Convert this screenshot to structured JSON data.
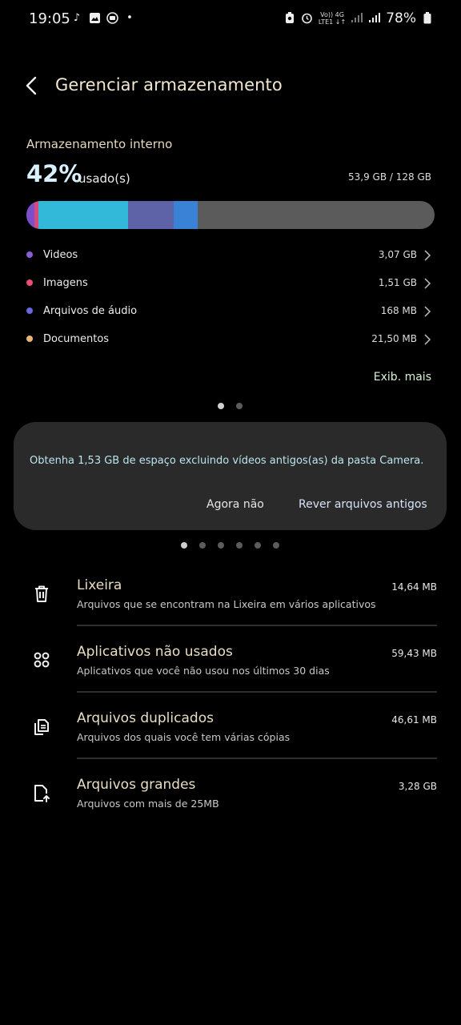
{
  "status_bar": {
    "time": "19:05",
    "battery": "78%",
    "network_top": "Vo)) 4G",
    "network_bottom": "LTE1 ↓↑"
  },
  "header": {
    "title": "Gerenciar armazenamento"
  },
  "storage": {
    "label": "Armazenamento interno",
    "percent": "42%",
    "used_label": "usado(s)",
    "total": "53,9 GB / 128 GB",
    "bar_segments": [
      {
        "name": "videos",
        "color": "#7b4fc9",
        "fraction": 0.02
      },
      {
        "name": "images",
        "color": "#d9487a",
        "fraction": 0.01
      },
      {
        "name": "other",
        "color": "#32b9d9",
        "fraction": 0.22
      },
      {
        "name": "system",
        "color": "#5e63a8",
        "fraction": 0.11
      },
      {
        "name": "apps",
        "color": "#3a82d6",
        "fraction": 0.06
      }
    ],
    "categories": [
      {
        "label": "Videos",
        "value": "3,07 GB",
        "color": "#8a5cd8"
      },
      {
        "label": "Imagens",
        "value": "1,51 GB",
        "color": "#e94f72"
      },
      {
        "label": "Arquivos de áudio",
        "value": "168 MB",
        "color": "#6a66e0"
      },
      {
        "label": "Documentos",
        "value": "21,50 MB",
        "color": "#e8b776"
      }
    ],
    "see_more": "Exib. mais"
  },
  "suggestion": {
    "text": "Obtenha 1,53 GB de espaço excluindo vídeos antigos(as) da pasta Camera.",
    "not_now": "Agora não",
    "review": "Rever arquivos antigos"
  },
  "options": [
    {
      "title": "Lixeira",
      "subtitle": "Arquivos que se encontram na Lixeira em vários aplicativos",
      "size": "14,64 MB",
      "icon": "trash-icon"
    },
    {
      "title": "Aplicativos não usados",
      "subtitle": "Aplicativos que você não usou nos últimos 30 dias",
      "size": "59,43 MB",
      "icon": "apps-icon"
    },
    {
      "title": "Arquivos duplicados",
      "subtitle": "Arquivos dos quais você tem várias cópias",
      "size": "46,61 MB",
      "icon": "duplicate-files-icon"
    },
    {
      "title": "Arquivos grandes",
      "subtitle": "Arquivos com mais de 25MB",
      "size": "3,28 GB",
      "icon": "large-file-icon"
    }
  ]
}
